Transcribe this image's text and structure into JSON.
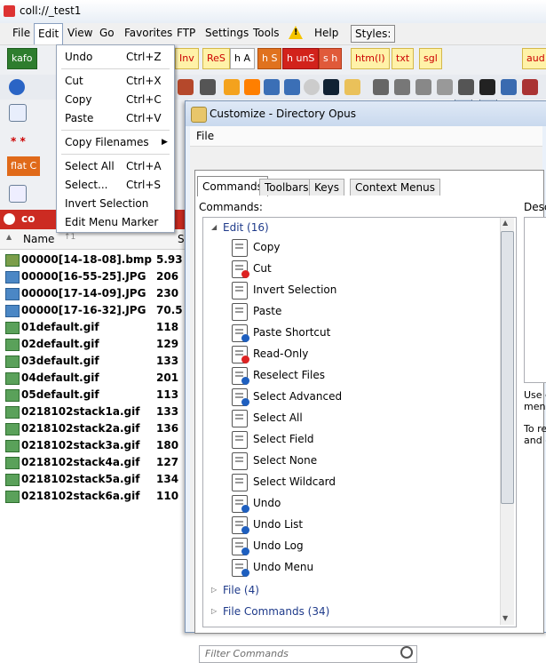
{
  "window": {
    "title": "coll://_test1"
  },
  "menubar": {
    "items": [
      "File",
      "Edit",
      "View",
      "Go",
      "Favorites",
      "FTP",
      "Settings",
      "Tools",
      "Help"
    ],
    "styles_label": "Styles:"
  },
  "toolbar1": {
    "buttons": [
      "kafo",
      "Inv",
      "ReS",
      "h A",
      "h S",
      "h unS",
      "s h",
      "htm(l)",
      "txt",
      "sgl",
      "aud"
    ]
  },
  "edit_menu": {
    "items": [
      {
        "label": "Undo",
        "shortcut": "Ctrl+Z"
      },
      {
        "label": "Cut",
        "shortcut": "Ctrl+X"
      },
      {
        "label": "Copy",
        "shortcut": "Ctrl+C"
      },
      {
        "label": "Paste",
        "shortcut": "Ctrl+V"
      },
      {
        "label": "Copy Filenames",
        "shortcut": ""
      },
      {
        "label": "Select All",
        "shortcut": "Ctrl+A"
      },
      {
        "label": "Select...",
        "shortcut": "Ctrl+S"
      },
      {
        "label": "Invert Selection",
        "shortcut": ""
      },
      {
        "label": "Edit Menu Marker",
        "shortcut": ""
      }
    ]
  },
  "left_toolbar": {
    "stars": "* *",
    "flat": "flat C"
  },
  "lister": {
    "tab": "co",
    "column_name": "Name",
    "column_size": "S",
    "sort_indicator": "↑1",
    "files": [
      {
        "name": "00000[14-18-08].bmp",
        "size": "5.93",
        "type": "bmp"
      },
      {
        "name": "00000[16-55-25].JPG",
        "size": "206",
        "type": "jpg"
      },
      {
        "name": "00000[17-14-09].JPG",
        "size": "230",
        "type": "jpg"
      },
      {
        "name": "00000[17-16-32].JPG",
        "size": "70.5",
        "type": "jpg"
      },
      {
        "name": "01default.gif",
        "size": "118",
        "type": "gif"
      },
      {
        "name": "02default.gif",
        "size": "129",
        "type": "gif"
      },
      {
        "name": "03default.gif",
        "size": "133",
        "type": "gif"
      },
      {
        "name": "04default.gif",
        "size": "201",
        "type": "gif"
      },
      {
        "name": "05default.gif",
        "size": "113",
        "type": "gif"
      },
      {
        "name": "0218102stack1a.gif",
        "size": "133",
        "type": "gif"
      },
      {
        "name": "0218102stack2a.gif",
        "size": "136",
        "type": "gif"
      },
      {
        "name": "0218102stack3a.gif",
        "size": "180",
        "type": "gif"
      },
      {
        "name": "0218102stack4a.gif",
        "size": "127",
        "type": "gif"
      },
      {
        "name": "0218102stack5a.gif",
        "size": "134",
        "type": "gif"
      },
      {
        "name": "0218102stack6a.gif",
        "size": "110",
        "type": "gif"
      }
    ]
  },
  "dialog": {
    "title": "Customize - Directory Opus",
    "menu_file": "File",
    "tabs": [
      "Commands",
      "Toolbars",
      "Keys",
      "Context Menus"
    ],
    "commands_label": "Commands:",
    "description_label": "Desc",
    "filter_placeholder": "Filter Commands",
    "desc_lines": [
      "Use c",
      "menu",
      "To re",
      "and c"
    ],
    "tree": {
      "edit_category": "Edit (16)",
      "edit_commands": [
        "Copy",
        "Cut",
        "Invert Selection",
        "Paste",
        "Paste Shortcut",
        "Read-Only",
        "Reselect Files",
        "Select Advanced",
        "Select All",
        "Select Field",
        "Select None",
        "Select Wildcard",
        "Undo",
        "Undo List",
        "Undo Log",
        "Undo Menu"
      ],
      "other_categories": [
        "File (4)",
        "File Commands (34)"
      ]
    }
  },
  "colors": {
    "accent_red": "#cc2b22",
    "tree_blue": "#1e3a8a",
    "dialog_frame": "#7d95b5"
  }
}
